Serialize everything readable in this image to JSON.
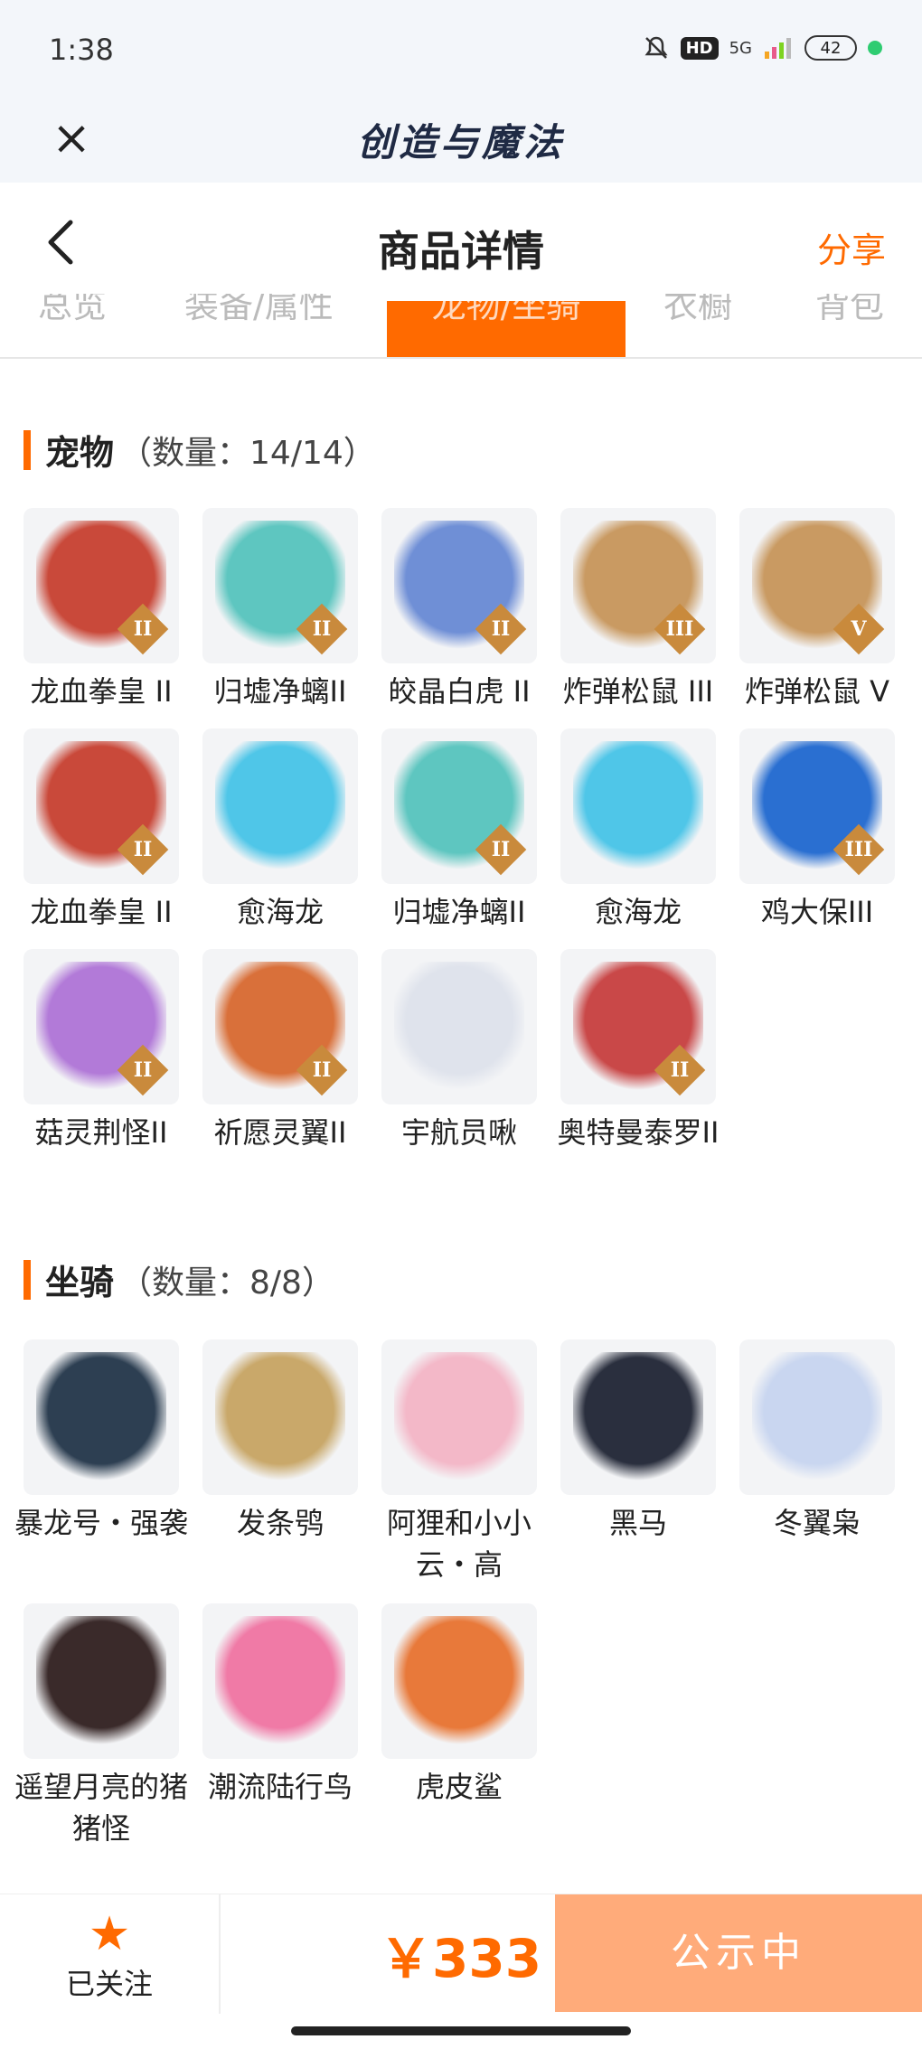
{
  "status_bar": {
    "time": "1:38",
    "hd": "HD",
    "signal": "5G",
    "battery": "42"
  },
  "app_header": {
    "title": "创造与魔法"
  },
  "page_header": {
    "title": "商品详情",
    "share": "分享"
  },
  "tabs": [
    {
      "label": "总览"
    },
    {
      "label": "装备/属性"
    },
    {
      "label": "龙物/坐骑",
      "active": true
    },
    {
      "label": "衣橱"
    },
    {
      "label": "背包"
    }
  ],
  "pets": {
    "title": "宠物",
    "count": "（数量：14/14）",
    "items": [
      {
        "name": "龙血拳皇 II",
        "level": "II",
        "color": "#c9493a"
      },
      {
        "name": "归墟净螭II",
        "level": "II",
        "color": "#5ec6c0"
      },
      {
        "name": "皎晶白虎 II",
        "level": "II",
        "color": "#6f8fd6"
      },
      {
        "name": "炸弹松鼠 III",
        "level": "III",
        "color": "#c99a62"
      },
      {
        "name": "炸弹松鼠 V",
        "level": "V",
        "color": "#c99a62"
      },
      {
        "name": "龙血拳皇 II",
        "level": "II",
        "color": "#c9493a"
      },
      {
        "name": "愈海龙",
        "level": "",
        "color": "#4fc6e8"
      },
      {
        "name": "归墟净螭II",
        "level": "II",
        "color": "#5ec6c0"
      },
      {
        "name": "愈海龙",
        "level": "",
        "color": "#4fc6e8"
      },
      {
        "name": "鸡大保III",
        "level": "III",
        "color": "#2a6fd1"
      },
      {
        "name": "菇灵荆怪II",
        "level": "II",
        "color": "#b27ad8"
      },
      {
        "name": "祈愿灵翼II",
        "level": "II",
        "color": "#d9703a"
      },
      {
        "name": "宇航员啾",
        "level": "",
        "color": "#dfe3ec"
      },
      {
        "name": "奥特曼泰罗II",
        "level": "II",
        "color": "#c94848"
      }
    ]
  },
  "mounts": {
    "title": "坐骑",
    "count": "（数量：8/8）",
    "items": [
      {
        "name": "暴龙号・强袭",
        "color": "#2d3f52"
      },
      {
        "name": "发条鸮",
        "color": "#c9a86a"
      },
      {
        "name": "阿狸和小小云・高",
        "color": "#f3b8c8"
      },
      {
        "name": "黑马",
        "color": "#2a2f3e"
      },
      {
        "name": "冬翼枭",
        "color": "#c9d6f0"
      },
      {
        "name": "遥望月亮的猪猪怪",
        "color": "#3a2a2a"
      },
      {
        "name": "潮流陆行鸟",
        "color": "#f07aa6"
      },
      {
        "name": "虎皮鲨",
        "color": "#e8793a"
      }
    ]
  },
  "bottom_bar": {
    "follow_label": "已关注",
    "price": "￥333",
    "status": "公示中"
  }
}
